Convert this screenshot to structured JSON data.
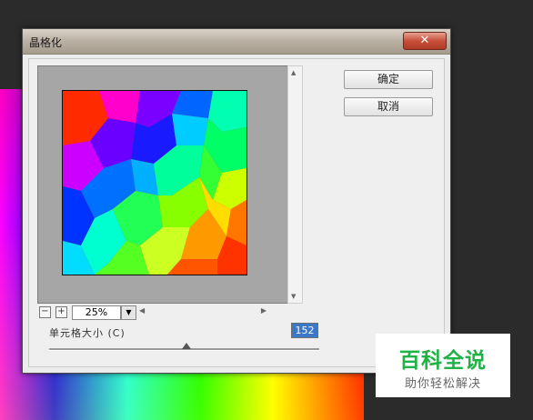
{
  "dialog": {
    "title": "晶格化",
    "close_glyph": "✕",
    "ok_label": "确定",
    "cancel_label": "取消"
  },
  "preview": {
    "zoom_out_glyph": "−",
    "zoom_in_glyph": "+",
    "zoom_value": "25%",
    "dropdown_glyph": "▼",
    "scroll_up": "▲",
    "scroll_down": "▼",
    "scroll_left": "◀",
    "scroll_right": "▶"
  },
  "parameter": {
    "label": "单元格大小 (C)",
    "value": "152",
    "slider_fraction": 0.51
  },
  "watermark": {
    "title": "百科全说",
    "subtitle": "助你轻松解决"
  },
  "colors": {
    "accent_value_bg": "#3b78c8",
    "watermark_green": "#1fb345"
  }
}
